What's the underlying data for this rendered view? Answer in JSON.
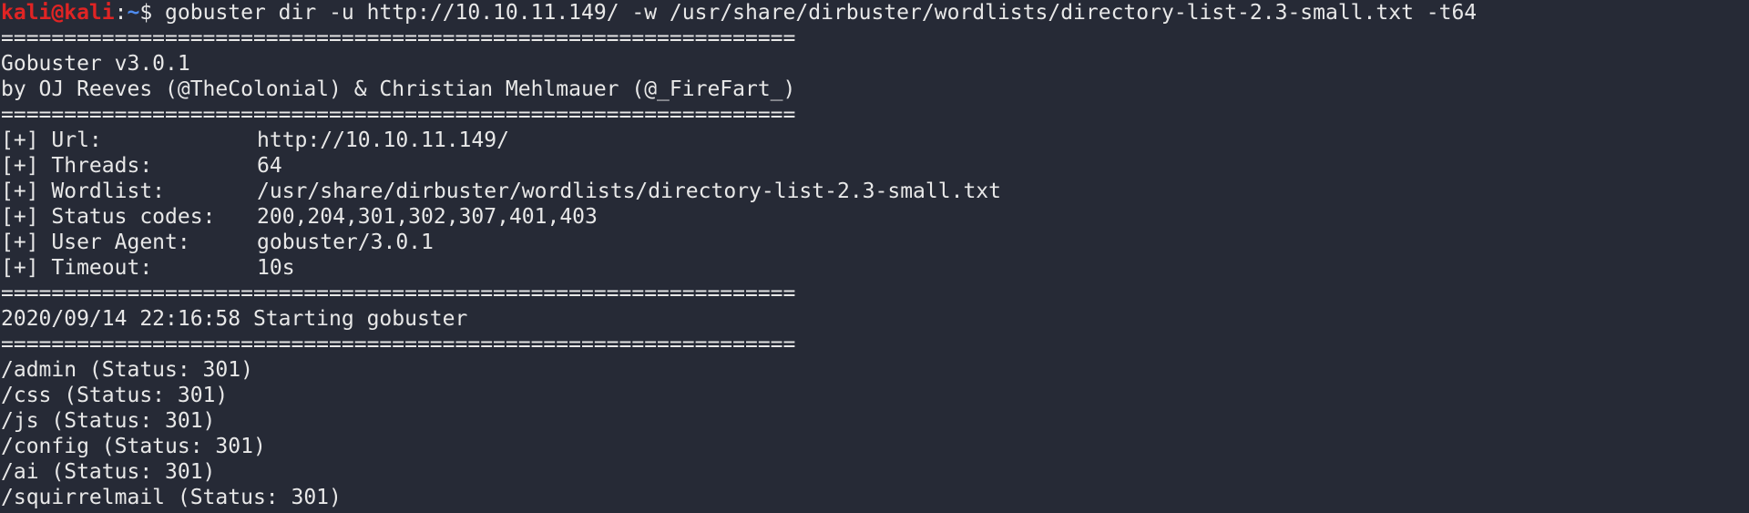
{
  "prompt": {
    "user_host": "kali@kali",
    "separator": ":",
    "path": "~",
    "symbol": "$",
    "command": " gobuster dir -u http://10.10.11.149/ -w /usr/share/dirbuster/wordlists/directory-list-2.3-small.txt -t64"
  },
  "separator_line": "===============================================================",
  "banner": {
    "title": "Gobuster v3.0.1",
    "authors": "by OJ Reeves (@TheColonial) & Christian Mehlmauer (@_FireFart_)"
  },
  "config": [
    {
      "key": "[+] Url:",
      "value": "http://10.10.11.149/"
    },
    {
      "key": "[+] Threads:",
      "value": "64"
    },
    {
      "key": "[+] Wordlist:",
      "value": "/usr/share/dirbuster/wordlists/directory-list-2.3-small.txt"
    },
    {
      "key": "[+] Status codes:",
      "value": "200,204,301,302,307,401,403"
    },
    {
      "key": "[+] User Agent:",
      "value": "gobuster/3.0.1"
    },
    {
      "key": "[+] Timeout:",
      "value": "10s"
    }
  ],
  "start_message": "2020/09/14 22:16:58 Starting gobuster",
  "results": [
    "/admin (Status: 301)",
    "/css (Status: 301)",
    "/js (Status: 301)",
    "/config (Status: 301)",
    "/ai (Status: 301)",
    "/squirrelmail (Status: 301)"
  ],
  "colors": {
    "background": "#262a36",
    "foreground": "#e8e8e8",
    "user_host": "#e02424",
    "path": "#4f8cf0"
  }
}
